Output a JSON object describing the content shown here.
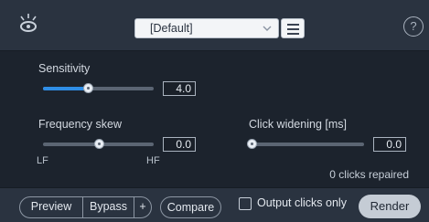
{
  "header": {
    "logo_icon": "spark-bulb-icon",
    "preset_value": "[Default]",
    "menu_icon": "hamburger-menu-icon",
    "help_label": "?"
  },
  "controls": {
    "sensitivity": {
      "label": "Sensitivity",
      "value": "4.0",
      "level": 0.4
    },
    "frequency_skew": {
      "label": "Frequency skew",
      "value": "0.0",
      "level": 0.5,
      "min_label": "LF",
      "max_label": "HF"
    },
    "click_widening": {
      "label": "Click widening [ms]",
      "value": "0.0",
      "level": 0.0
    }
  },
  "status": {
    "clicks_repaired": "0 clicks repaired"
  },
  "footer": {
    "preview_label": "Preview",
    "bypass_label": "Bypass",
    "plus_label": "+",
    "compare_label": "Compare",
    "output_clicks_label": "Output clicks only",
    "output_clicks_checked": false,
    "render_label": "Render"
  },
  "colors": {
    "accent": "#2f8ee6",
    "panel": "#1c232d",
    "header": "#2a3340"
  }
}
